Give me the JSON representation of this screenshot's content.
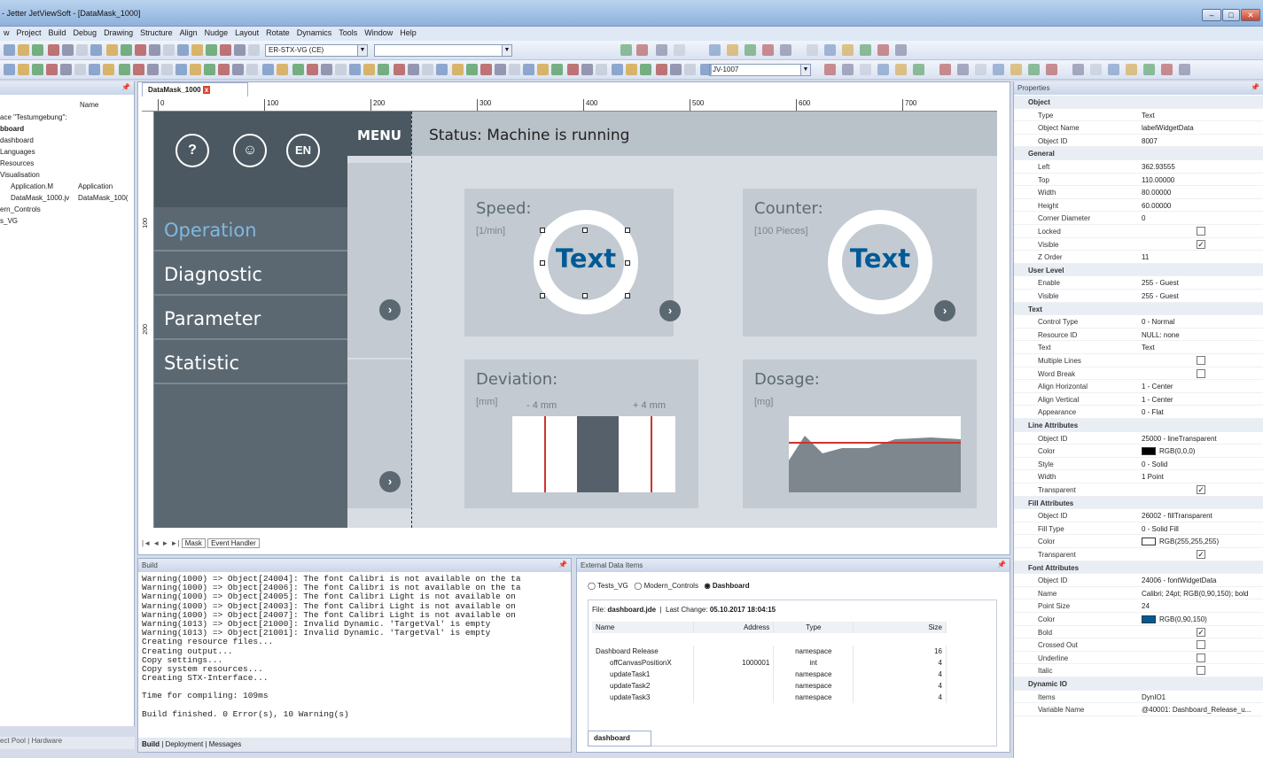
{
  "window": {
    "title": "- Jetter JetViewSoft - [DataMask_1000]"
  },
  "menu": [
    "w",
    "Project",
    "Build",
    "Debug",
    "Drawing",
    "Structure",
    "Align",
    "Nudge",
    "Layout",
    "Rotate",
    "Dynamics",
    "Tools",
    "Window",
    "Help"
  ],
  "toolbar": {
    "target_combo": "ER-STX-VG (CE)",
    "device_combo": "JV-1007"
  },
  "left_panel": {
    "header": "Name",
    "items": [
      "ace \"Testumgebung\":",
      "bboard",
      "dashboard",
      "Languages",
      "Resources",
      "Visualisation",
      "Application.M",
      "DataMask_1000.jv",
      "ern_Controls",
      "s_VG"
    ],
    "col2": [
      "Application",
      "DataMask_100("
    ],
    "bottom_tabs": [
      "ect Pool",
      "Hardware"
    ]
  },
  "document": {
    "tab": "DataMask_1000",
    "ruler_ticks": [
      "0",
      "100",
      "200",
      "300",
      "400",
      "500",
      "600",
      "700"
    ],
    "ruler_left_ticks": [
      "100",
      "200"
    ],
    "bottom_tabs": [
      "Mask",
      "Event Handler"
    ]
  },
  "hmi": {
    "header_buttons": [
      "?",
      "☺",
      "EN"
    ],
    "menu_label": "MENU",
    "status": "Status:  Machine is running",
    "nav": [
      "Operation",
      "Diagnostic",
      "Parameter",
      "Statistic"
    ],
    "tiles": [
      {
        "title": "Speed:",
        "unit": "[1/min]",
        "value": "Text"
      },
      {
        "title": "Counter:",
        "unit": "[100 Pieces]",
        "value": "Text"
      },
      {
        "title": "Deviation:",
        "unit": "[mm]",
        "left": "- 4 mm",
        "right": "+ 4 mm"
      },
      {
        "title": "Dosage:",
        "unit": "[mg]"
      }
    ],
    "colors": {
      "accent": "#005a96",
      "sidebar": "#5b6872",
      "tile": "#c3cad1"
    }
  },
  "build": {
    "title": "Build",
    "lines": [
      "Warning(1000) => Object[24004]: The font Calibri is not available on the ta",
      "Warning(1000) => Object[24006]: The font Calibri is not available on the ta",
      "Warning(1000) => Object[24005]: The font Calibri Light is not available on",
      "Warning(1000) => Object[24003]: The font Calibri Light is not available on",
      "Warning(1000) => Object[24007]: The font Calibri Light is not available on",
      "Warning(1013) => Object[21000]: Invalid Dynamic. 'TargetVal' is empty",
      "Warning(1013) => Object[21001]: Invalid Dynamic. 'TargetVal' is empty",
      "Creating resource files...",
      "Creating output...",
      "Copy settings...",
      "Copy system resources...",
      "Creating STX-Interface...",
      "",
      "Time for compiling: 109ms",
      "",
      "Build finished. 0 Error(s), 10 Warning(s)"
    ],
    "tabs": [
      "Build",
      "Deployment",
      "Messages"
    ]
  },
  "external": {
    "title": "External Data Items",
    "radios": [
      "Tests_VG",
      "Modern_Controls",
      "Dashboard"
    ],
    "file_label": "File:",
    "file": "dashboard.jde",
    "change_label": "Last Change:",
    "change": "05.10.2017 18:04:15",
    "columns": [
      "Name",
      "Address",
      "Type",
      "Size"
    ],
    "rows": [
      [
        "Dashboard Release",
        "",
        "namespace",
        "16"
      ],
      [
        "offCanvasPositionX",
        "1000001",
        "int",
        "4"
      ],
      [
        "updateTask1",
        "",
        "namespace",
        "4"
      ],
      [
        "updateTask2",
        "",
        "namespace",
        "4"
      ],
      [
        "updateTask3",
        "",
        "namespace",
        "4"
      ]
    ],
    "tab": "dashboard"
  },
  "properties": {
    "title": "Properties",
    "rows": [
      {
        "s": "Object"
      },
      {
        "k": "Type",
        "v": "Text"
      },
      {
        "k": "Object Name",
        "v": "labelWidgetData"
      },
      {
        "k": "Object ID",
        "v": "8007"
      },
      {
        "s": "General"
      },
      {
        "k": "Left",
        "v": "362.93555"
      },
      {
        "k": "Top",
        "v": "110.00000"
      },
      {
        "k": "Width",
        "v": "80.00000"
      },
      {
        "k": "Height",
        "v": "60.00000"
      },
      {
        "k": "Corner Diameter",
        "v": "0"
      },
      {
        "k": "Locked",
        "c": false
      },
      {
        "k": "Visible",
        "c": true
      },
      {
        "k": "Z Order",
        "v": "11"
      },
      {
        "s": "User Level"
      },
      {
        "k": "Enable",
        "v": "255 - Guest"
      },
      {
        "k": "Visible",
        "v": "255 - Guest"
      },
      {
        "s": "Text"
      },
      {
        "k": "Control Type",
        "v": "0 - Normal"
      },
      {
        "k": "Resource ID",
        "v": "NULL: none"
      },
      {
        "k": "Text",
        "v": "Text"
      },
      {
        "k": "Multiple Lines",
        "c": false
      },
      {
        "k": "Word Break",
        "c": false
      },
      {
        "k": "Align Horizontal",
        "v": "1 - Center"
      },
      {
        "k": "Align Vertical",
        "v": "1 - Center"
      },
      {
        "k": "Appearance",
        "v": "0 - Flat"
      },
      {
        "s": "Line Attributes"
      },
      {
        "k": "Object ID",
        "v": "25000 - lineTransparent"
      },
      {
        "k": "Color",
        "v": "RGB(0,0,0)",
        "sw": "#000000"
      },
      {
        "k": "Style",
        "v": "0 - Solid"
      },
      {
        "k": "Width",
        "v": "1 Point"
      },
      {
        "k": "Transparent",
        "c": true
      },
      {
        "s": "Fill Attributes"
      },
      {
        "k": "Object ID",
        "v": "26002 - fillTransparent"
      },
      {
        "k": "Fill Type",
        "v": "0 - Solid Fill"
      },
      {
        "k": "Color",
        "v": "RGB(255,255,255)",
        "sw": "#ffffff"
      },
      {
        "k": "Transparent",
        "c": true
      },
      {
        "s": "Font Attributes"
      },
      {
        "k": "Object ID",
        "v": "24006 - fontWidgetData"
      },
      {
        "k": "Name",
        "v": "Calibri; 24pt; RGB(0,90,150); bold"
      },
      {
        "k": "Point Size",
        "v": "24"
      },
      {
        "k": "Color",
        "v": "RGB(0,90,150)",
        "sw": "#005a96"
      },
      {
        "k": "Bold",
        "c": true
      },
      {
        "k": "Crossed Out",
        "c": false
      },
      {
        "k": "Underline",
        "c": false
      },
      {
        "k": "Italic",
        "c": false
      },
      {
        "s": "Dynamic IO"
      },
      {
        "k": "Items",
        "v": "DynIO1"
      },
      {
        "k": "Variable Name",
        "v": "@40001: Dashboard_Release_u..."
      }
    ]
  }
}
